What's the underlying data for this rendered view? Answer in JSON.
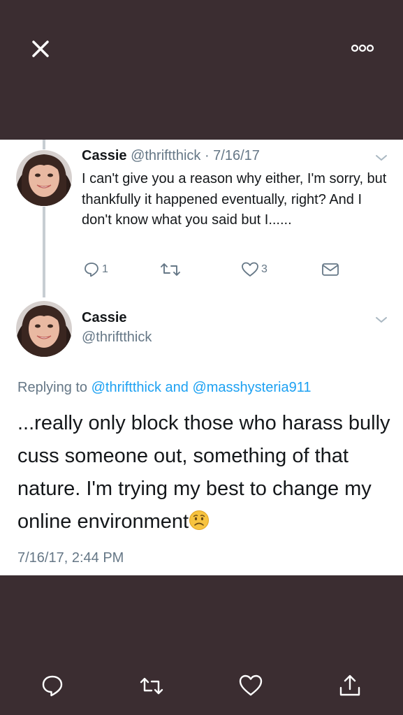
{
  "viewer": {
    "close_icon": "close-icon",
    "more_icon": "more-dots-icon"
  },
  "reply_tweet": {
    "name": "Cassie",
    "handle": "@thriftthick",
    "date": "· 7/16/17",
    "text": "I can't give you a reason why either, I'm sorry, but thankfully it happened eventually, right? And I don't know what you said but I......",
    "reply_count": "1",
    "like_count": "3"
  },
  "main_tweet": {
    "name": "Cassie",
    "handle": "@thriftthick",
    "replying_prefix": "Replying to",
    "reply_to_1": "@thriftthick",
    "reply_and": "and",
    "reply_to_2": "@masshysteria911",
    "text": "...really only block those who harass bully cuss someone out, something of that nature. I'm trying my best to change my online environment",
    "emoji": "worried-face-emoji",
    "timestamp": "7/16/17, 2:44 PM"
  },
  "colors": {
    "background": "#3b2d31",
    "link": "#1da1f2",
    "muted": "#657786"
  }
}
